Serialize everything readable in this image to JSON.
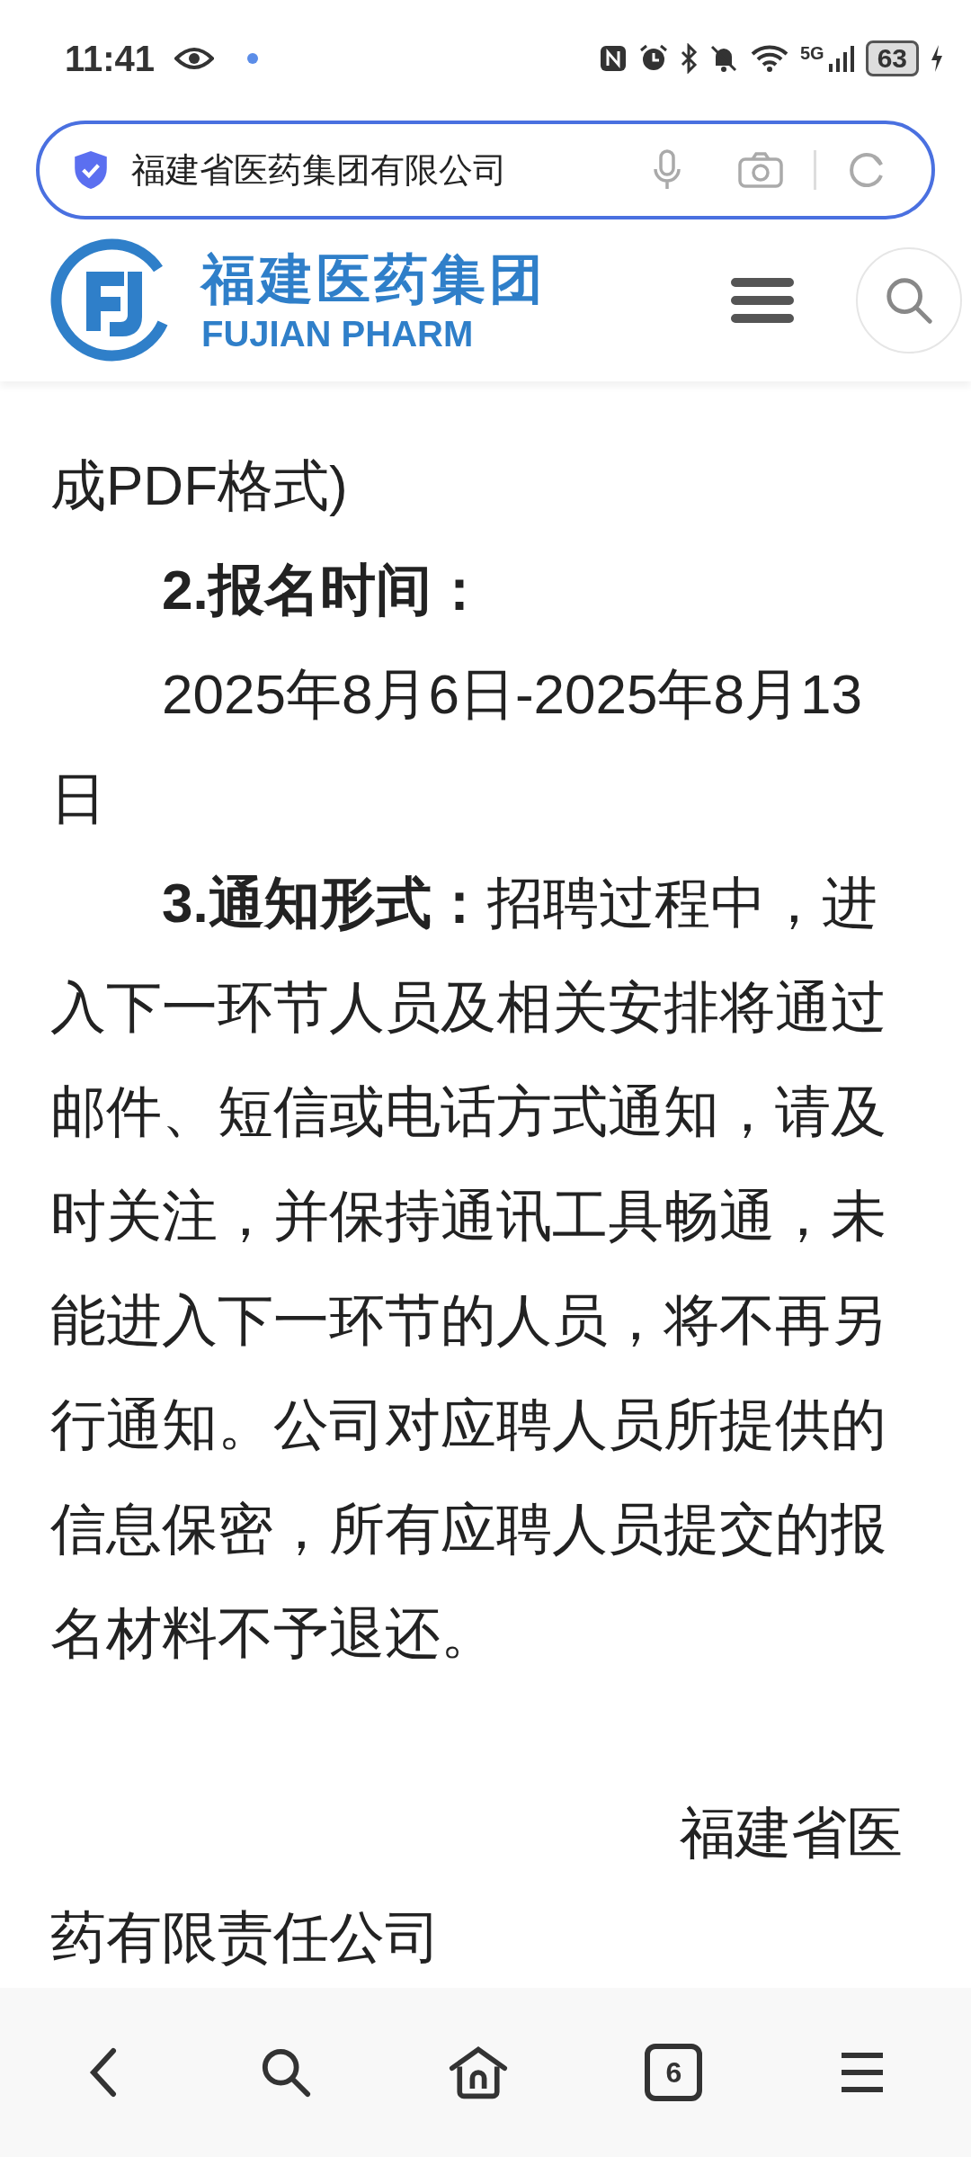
{
  "status_bar": {
    "time": "11:41",
    "network": "5G",
    "battery": "63"
  },
  "address_bar": {
    "text": "福建省医药集团有限公司"
  },
  "site_header": {
    "logo_title": "福建医药集团",
    "logo_subtitle": "FUJIAN PHARM"
  },
  "article": {
    "paragraphs": [
      {
        "kind": "plain",
        "text": "成PDF格式)"
      },
      {
        "kind": "indent",
        "text": "**2.报名时间：**"
      },
      {
        "kind": "indent",
        "text": "2025年8月6日-2025年8月13日"
      },
      {
        "kind": "indent",
        "text": "**3.通知形式：**招聘过程中，进入下一环节人员及相关安排将通过邮件、短信或电话方式通知，请及时关注，并保持通讯工具畅通，未能进入下一环节的人员，将不再另行通知。公司对应聘人员所提供的信息保密，所有应聘人员提交的报名材料不予退还。"
      },
      {
        "kind": "signature",
        "text": "福建省医药有限责任公司"
      }
    ]
  },
  "bottom_nav": {
    "tab_count": "6"
  }
}
